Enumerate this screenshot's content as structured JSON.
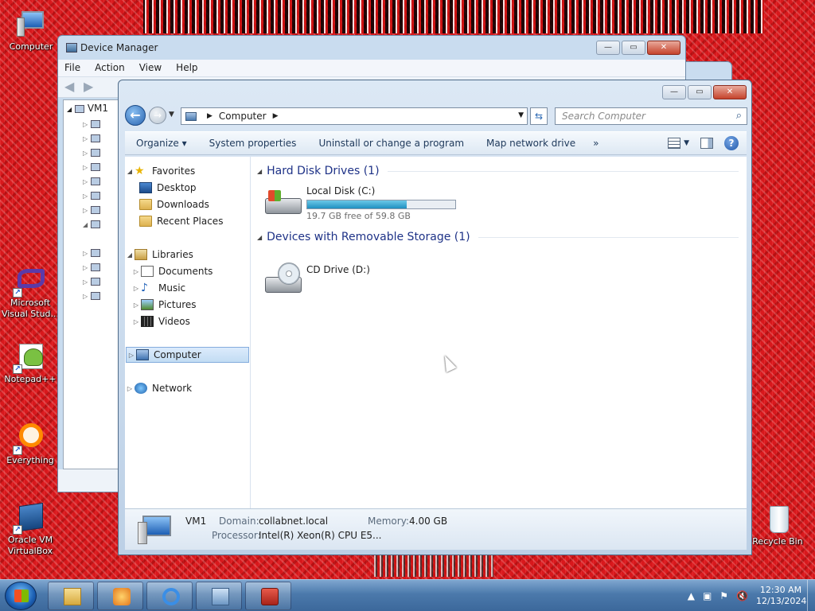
{
  "desktop": {
    "icons": [
      {
        "label": "Computer",
        "icon": "computer-icon"
      },
      {
        "label": "Microsoft Visual Stud...",
        "icon": "visual-studio-icon"
      },
      {
        "label": "Notepad++",
        "icon": "notepadpp-icon"
      },
      {
        "label": "Everything",
        "icon": "everything-icon"
      },
      {
        "label": "Oracle VM VirtualBox",
        "icon": "virtualbox-icon"
      },
      {
        "label": "Recycle Bin",
        "icon": "recycle-bin-icon"
      }
    ]
  },
  "device_manager": {
    "title": "Device Manager",
    "menu": [
      "File",
      "Action",
      "View",
      "Help"
    ],
    "tree_root": "VM1"
  },
  "explorer": {
    "address": {
      "root": "Computer"
    },
    "search": {
      "placeholder": "Search Computer"
    },
    "commands": [
      "Organize",
      "System properties",
      "Uninstall or change a program",
      "Map network drive",
      "»"
    ],
    "organize_arrow": "▾",
    "nav": {
      "favorites": {
        "label": "Favorites",
        "items": [
          "Desktop",
          "Downloads",
          "Recent Places"
        ]
      },
      "libraries": {
        "label": "Libraries",
        "items": [
          "Documents",
          "Music",
          "Pictures",
          "Videos"
        ]
      },
      "computer": "Computer",
      "network": "Network"
    },
    "groups": {
      "hard_disks": {
        "title": "Hard Disk Drives (1)"
      },
      "removable": {
        "title": "Devices with Removable Storage (1)"
      }
    },
    "drives": {
      "c": {
        "name": "Local Disk (C:)",
        "free_text": "19.7 GB free of 59.8 GB",
        "used_fraction": 0.67
      },
      "d": {
        "name": "CD Drive (D:)"
      }
    },
    "details": {
      "name": "VM1",
      "domain_label": "Domain:",
      "domain": "collabnet.local",
      "memory_label": "Memory:",
      "memory": "4.00 GB",
      "processor_label": "Processor:",
      "processor": "Intel(R) Xeon(R) CPU E5..."
    }
  },
  "taskbar": {
    "clock": {
      "time": "12:30 AM",
      "date": "12/13/2024"
    }
  }
}
